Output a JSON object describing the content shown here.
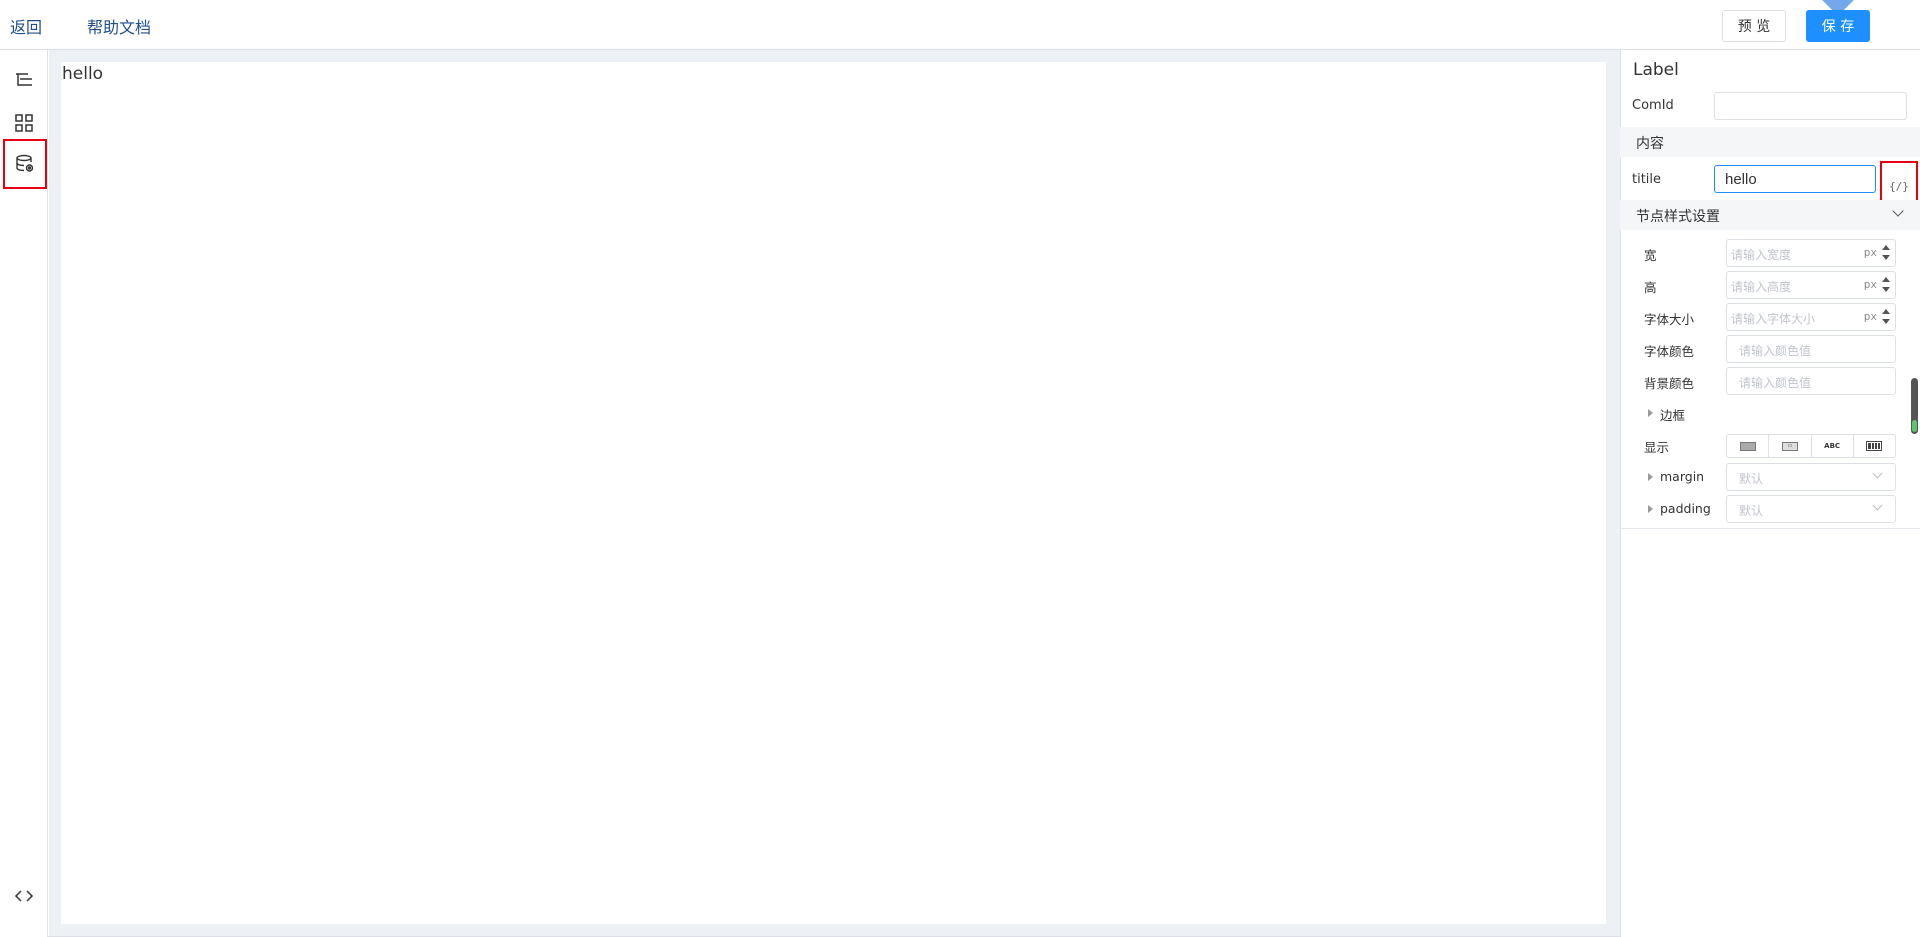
{
  "topbar": {
    "back_label": "返回",
    "help_label": "帮助文档",
    "preview_label": "预 览",
    "save_label": "保 存"
  },
  "toolbar": {
    "items": [
      "outline-tree-icon",
      "components-grid-icon",
      "datasource-icon"
    ],
    "bottom_icon": "code-icon"
  },
  "canvas": {
    "label_text": "hello"
  },
  "inspector": {
    "component_type": "Label",
    "comid_label": "ComId",
    "comid_value": "",
    "content_section": "内容",
    "title_label": "titile",
    "title_value": "hello",
    "expression_button": "{/}",
    "style_section": "节点样式设置",
    "width_label": "宽",
    "width_placeholder": "请输入宽度",
    "height_label": "高",
    "height_placeholder": "请输入高度",
    "fontsize_label": "字体大小",
    "fontsize_placeholder": "请输入字体大小",
    "unit": "px",
    "fontcolor_label": "字体颜色",
    "fontcolor_placeholder": "请输入颜色值",
    "bgcolor_label": "背景颜色",
    "bgcolor_placeholder": "请输入颜色值",
    "border_label": "边框",
    "display_label": "显示",
    "display_options": [
      "block",
      "inline-block",
      "inline",
      "flex"
    ],
    "display_inline_text": "ABC",
    "margin_label": "margin",
    "margin_value": "默认",
    "padding_label": "padding",
    "padding_value": "默认"
  },
  "colors": {
    "accent": "#1e8fff",
    "highlight": "#e60012",
    "canvas_bg": "#edf0f4"
  }
}
